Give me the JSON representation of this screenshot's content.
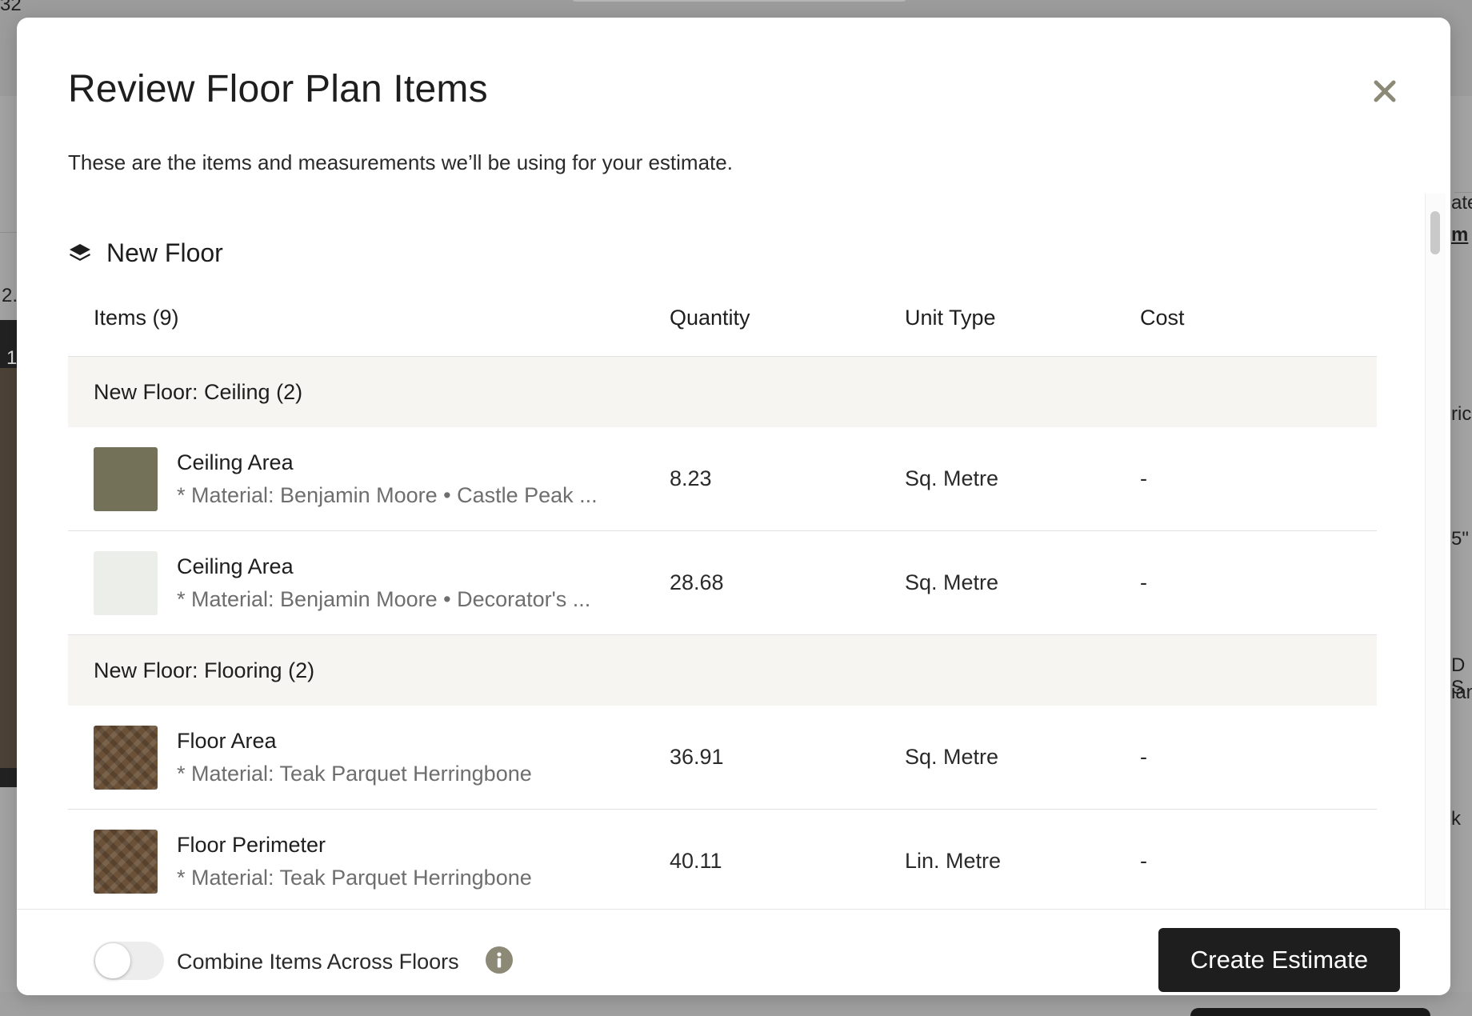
{
  "background": {
    "text_top_left": "32",
    "text_left_1": "2.",
    "text_left_2": "1",
    "text_right_1": "ate",
    "text_right_2": "m",
    "text_right_3": "ric",
    "text_right_4": "5\"",
    "text_right_5": "D S",
    "text_right_6": "ian",
    "text_right_7": "k"
  },
  "modal": {
    "title": "Review Floor Plan Items",
    "subtitle": "These are the items and measurements we’ll be using for your estimate.",
    "close_icon": "close-icon"
  },
  "floor": {
    "name": "New Floor",
    "icon": "layers-icon"
  },
  "table": {
    "headers": {
      "items": "Items (9)",
      "quantity": "Quantity",
      "unit_type": "Unit Type",
      "cost": "Cost"
    },
    "groups": [
      {
        "label": "New Floor: Ceiling (2)",
        "items": [
          {
            "name": "Ceiling Area",
            "material": "* Material: Benjamin Moore • Castle Peak ...",
            "quantity": "8.23",
            "unit": "Sq. Metre",
            "cost": "-",
            "swatch_color": "#737158"
          },
          {
            "name": "Ceiling Area",
            "material": "* Material: Benjamin Moore • Decorator's ...",
            "quantity": "28.68",
            "unit": "Sq. Metre",
            "cost": "-",
            "swatch_color": "#eceee9"
          }
        ]
      },
      {
        "label": "New Floor: Flooring (2)",
        "items": [
          {
            "name": "Floor Area",
            "material": "* Material: Teak Parquet Herringbone",
            "quantity": "36.91",
            "unit": "Sq. Metre",
            "cost": "-",
            "swatch_color": "#6b5138"
          },
          {
            "name": "Floor Perimeter",
            "material": "* Material: Teak Parquet Herringbone",
            "quantity": "40.11",
            "unit": "Lin. Metre",
            "cost": "-",
            "swatch_color": "#6b5138"
          }
        ]
      }
    ]
  },
  "footer": {
    "toggle_label": "Combine Items Across Floors",
    "toggle_on": false,
    "info_icon": "info-icon",
    "create_button": "Create Estimate"
  },
  "colors": {
    "primary_button": "#1e1e1e",
    "group_row_bg": "#f6f5f2",
    "info_icon_bg": "#8c8a76",
    "close_icon": "#8c8a76"
  }
}
